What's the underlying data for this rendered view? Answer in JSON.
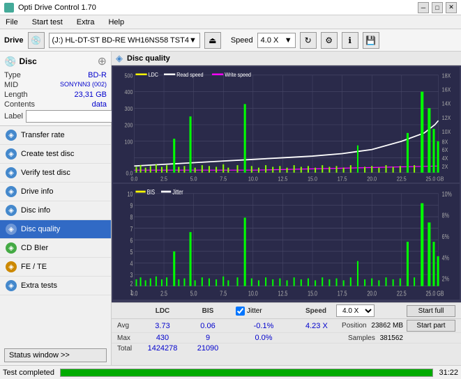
{
  "app": {
    "title": "Opti Drive Control 1.70",
    "icon": "💿"
  },
  "title_controls": {
    "minimize": "─",
    "maximize": "□",
    "close": "✕"
  },
  "menu": {
    "items": [
      "File",
      "Start test",
      "Extra",
      "Help"
    ]
  },
  "drive_toolbar": {
    "drive_label": "Drive",
    "drive_value": "(J:) HL-DT-ST BD-RE  WH16NS58 TST4",
    "speed_label": "Speed",
    "speed_value": "4.0 X"
  },
  "disc": {
    "label": "Disc",
    "type_label": "Type",
    "type_value": "BD-R",
    "mid_label": "MID",
    "mid_value": "SONYNN3 (002)",
    "length_label": "Length",
    "length_value": "23,31 GB",
    "contents_label": "Contents",
    "contents_value": "data",
    "label_label": "Label",
    "label_value": ""
  },
  "nav": {
    "items": [
      {
        "id": "transfer-rate",
        "label": "Transfer rate",
        "icon": "◈"
      },
      {
        "id": "create-test-disc",
        "label": "Create test disc",
        "icon": "◈"
      },
      {
        "id": "verify-test-disc",
        "label": "Verify test disc",
        "icon": "◈"
      },
      {
        "id": "drive-info",
        "label": "Drive info",
        "icon": "◈"
      },
      {
        "id": "disc-info",
        "label": "Disc info",
        "icon": "◈"
      },
      {
        "id": "disc-quality",
        "label": "Disc quality",
        "icon": "◈",
        "active": true
      },
      {
        "id": "cd-bier",
        "label": "CD BIer",
        "icon": "◈"
      },
      {
        "id": "fe-te",
        "label": "FE / TE",
        "icon": "◈"
      },
      {
        "id": "extra-tests",
        "label": "Extra tests",
        "icon": "◈"
      }
    ]
  },
  "status_window": {
    "label": "Status window >>"
  },
  "quality_panel": {
    "title": "Disc quality",
    "legend": {
      "ldc": {
        "label": "LDC",
        "color": "#ffff00"
      },
      "read_speed": {
        "label": "Read speed",
        "color": "#ffffff"
      },
      "write_speed": {
        "label": "Write speed",
        "color": "#ff00ff"
      }
    },
    "chart2_legend": {
      "bis": {
        "label": "BIS",
        "color": "#ffff00"
      },
      "jitter": {
        "label": "Jitter",
        "color": "#ffffff"
      }
    }
  },
  "stats": {
    "headers": [
      "",
      "LDC",
      "BIS",
      "",
      "Jitter",
      "Speed",
      ""
    ],
    "avg_label": "Avg",
    "avg_ldc": "3.73",
    "avg_bis": "0.06",
    "avg_jitter": "-0.1%",
    "max_label": "Max",
    "max_ldc": "430",
    "max_bis": "9",
    "max_jitter": "0.0%",
    "total_label": "Total",
    "total_ldc": "1424278",
    "total_bis": "21090",
    "speed_value": "4.23 X",
    "speed_set": "4.0 X",
    "position_label": "Position",
    "position_value": "23862 MB",
    "samples_label": "Samples",
    "samples_value": "381562",
    "jitter_checked": true,
    "start_full": "Start full",
    "start_part": "Start part"
  },
  "status_bar": {
    "text": "Test completed",
    "progress": 100,
    "time": "31:22"
  },
  "x_axis_labels": [
    "0.0",
    "2.5",
    "5.0",
    "7.5",
    "10.0",
    "12.5",
    "15.0",
    "17.5",
    "20.0",
    "22.5",
    "25.0 GB"
  ],
  "y_axis_left": [
    "500",
    "400",
    "300",
    "200",
    "100",
    "0.0"
  ],
  "y_axis_right": [
    "18X",
    "16X",
    "14X",
    "12X",
    "10X",
    "8X",
    "6X",
    "4X",
    "2X"
  ],
  "y2_axis_left": [
    "10",
    "9",
    "8",
    "7",
    "6",
    "5",
    "4",
    "3",
    "2",
    "1"
  ],
  "y2_axis_right": [
    "10%",
    "8%",
    "6%",
    "4%",
    "2%"
  ]
}
